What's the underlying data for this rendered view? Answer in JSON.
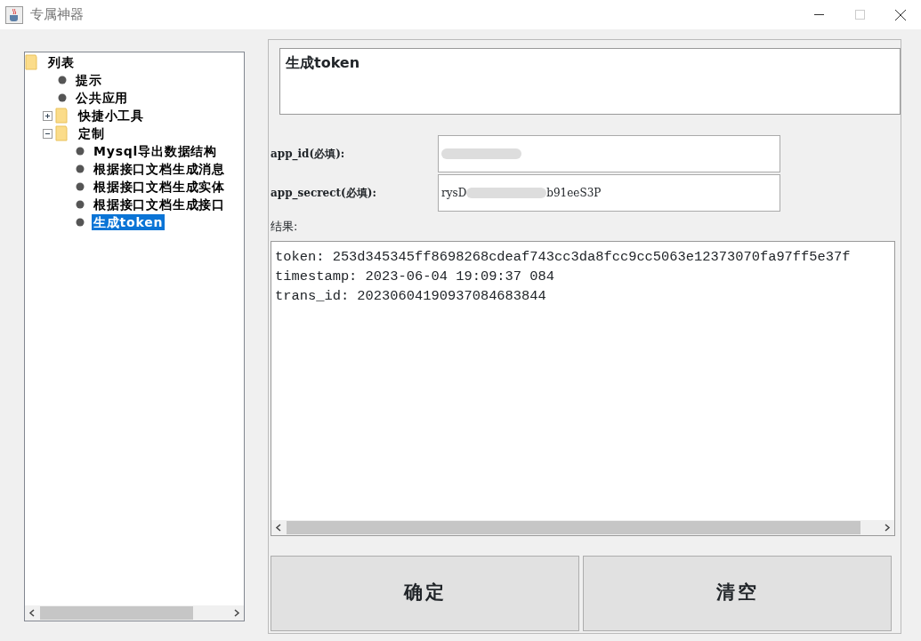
{
  "window": {
    "title": "专属神器"
  },
  "tree": [
    {
      "label": "列表",
      "kind": "folder",
      "selected": false,
      "children": [
        {
          "label": "提示",
          "kind": "leaf",
          "selected": false
        },
        {
          "label": "公共应用",
          "kind": "leaf",
          "selected": false
        },
        {
          "label": "快捷小工具",
          "kind": "folder",
          "expanded": false,
          "selected": false
        },
        {
          "label": "定制",
          "kind": "folder",
          "expanded": true,
          "selected": false,
          "children": [
            {
              "label": "Mysql导出数据结构",
              "kind": "leaf",
              "selected": false
            },
            {
              "label": "根据接口文档生成消息",
              "kind": "leaf",
              "selected": false
            },
            {
              "label": "根据接口文档生成实体",
              "kind": "leaf",
              "selected": false
            },
            {
              "label": "根据接口文档生成接口",
              "kind": "leaf",
              "selected": false
            },
            {
              "label": "生成token",
              "kind": "leaf",
              "selected": true
            }
          ]
        }
      ]
    }
  ],
  "heading": "生成token",
  "fields": [
    {
      "label": "app_id(必填):"
    },
    {
      "label": "app_secrect(必填):",
      "value_parts": [
        "rysD",
        "b91eeS3P"
      ]
    }
  ],
  "result": {
    "label": "结果:",
    "lines": [
      "token: 253d345345ff8698268cdeaf743cc3da8fcc9cc5063e12373070fa97ff5e37f",
      "timestamp: 2023-06-04 19:09:37 084",
      "trans_id: 20230604190937084683844"
    ]
  },
  "buttons": [
    "确定",
    "清空"
  ]
}
